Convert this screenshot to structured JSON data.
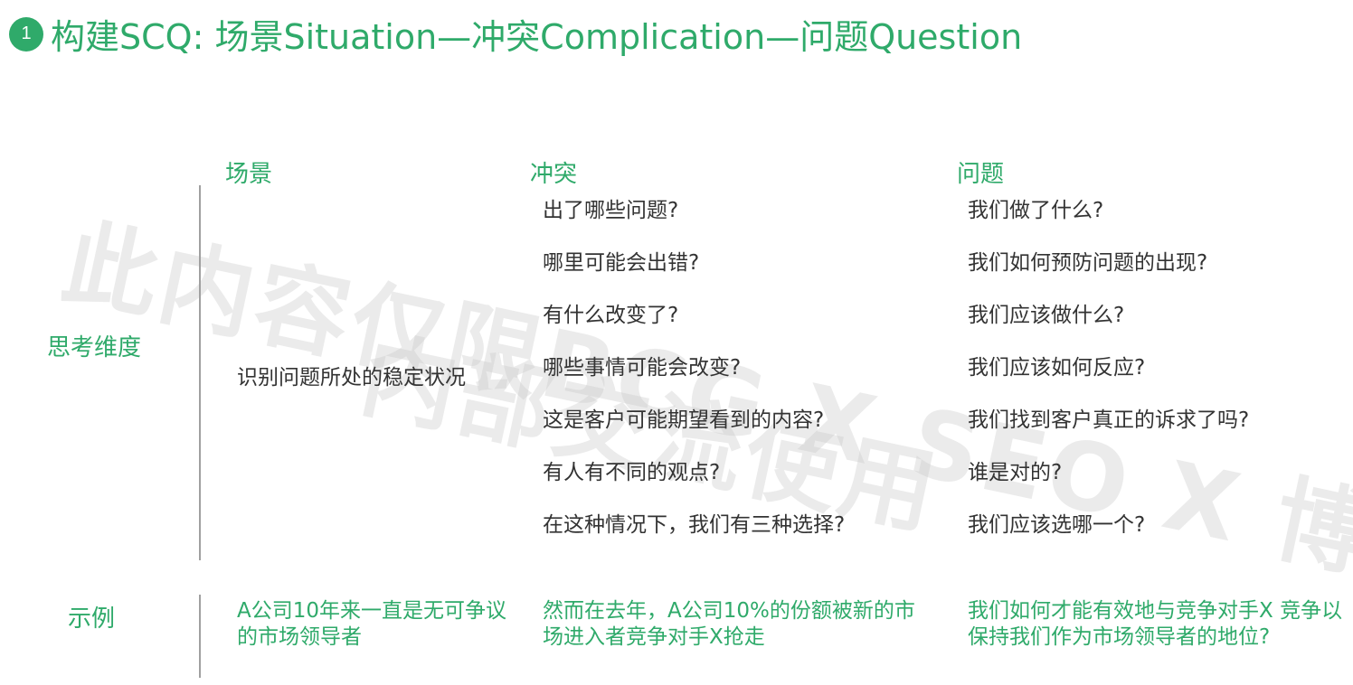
{
  "title": {
    "step_number": "1",
    "text": "构建SCQ: 场景Situation—冲突Complication—问题Question"
  },
  "watermark": {
    "line1": "此内容仅限BCG X SEO X 博联",
    "line2": "内部交流使用"
  },
  "columns": {
    "situation": "场景",
    "complication": "冲突",
    "question": "问题"
  },
  "rows": {
    "dimension_label": "思考维度",
    "example_label": "示例"
  },
  "dimension": {
    "situation": "识别问题所处的稳定状况",
    "complication": [
      "出了哪些问题?",
      "哪里可能会出错?",
      "有什么改变了?",
      "哪些事情可能会改变?",
      "这是客户可能期望看到的内容?",
      "有人有不同的观点?",
      "在这种情况下，我们有三种选择?"
    ],
    "question": [
      "我们做了什么?",
      "我们如何预防问题的出现?",
      "我们应该做什么?",
      "我们应该如何反应?",
      "我们找到客户真正的诉求了吗?",
      "谁是对的?",
      "我们应该选哪一个?"
    ]
  },
  "example": {
    "situation": "A公司10年来一直是无可争议的市场领导者",
    "complication": "然而在去年，A公司10%的份额被新的市场进入者竞争对手X抢走",
    "question": "我们如何才能有效地与竞争对手X 竞争以保持我们作为市场领导者的地位?"
  },
  "colors": {
    "accent": "#2faa6a",
    "text": "#333333",
    "divider": "#a0a0a0"
  }
}
